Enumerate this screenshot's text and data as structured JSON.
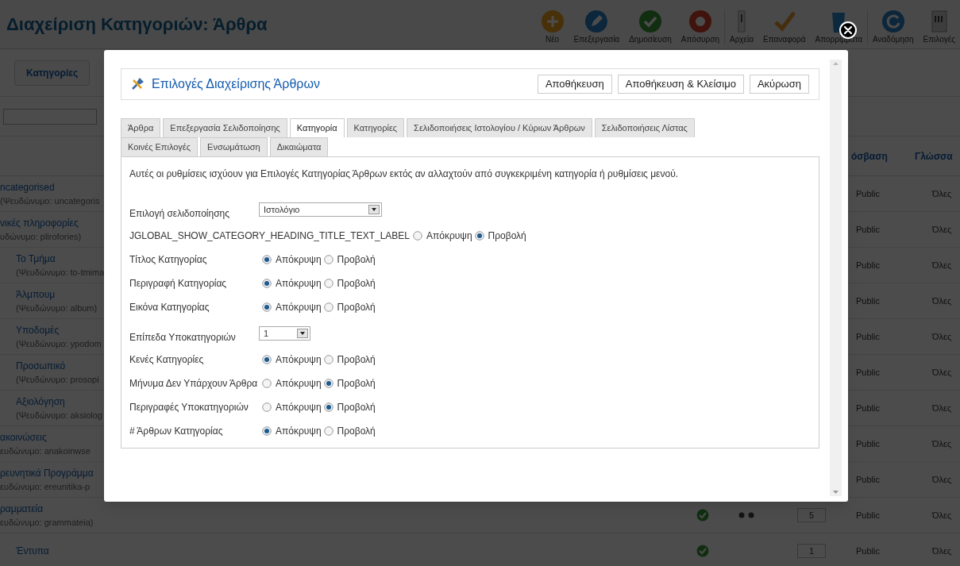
{
  "page": {
    "title": "Διαχείριση Κατηγοριών: Άρθρα",
    "toolbar": [
      {
        "label": "Νέο",
        "kind": "new"
      },
      {
        "label": "Επεξεργασία",
        "kind": "edit"
      },
      {
        "label": "Δημοσίευση",
        "kind": "publish"
      },
      {
        "label": "Απόσυρση",
        "kind": "unpublish"
      },
      {
        "label": "Αρχεία",
        "kind": "archive"
      },
      {
        "label": "Επαναφορά",
        "kind": "checkin"
      },
      {
        "label": "Απορρίμματα",
        "kind": "trash"
      },
      {
        "label": "Αναδόμηση",
        "kind": "rebuild"
      },
      {
        "label": "Επιλογές",
        "kind": "options"
      }
    ],
    "submenu": [
      "Κατηγορίες"
    ],
    "table": {
      "columns": [
        "όσβαση",
        "Γλώσσα"
      ],
      "rows": [
        {
          "title": "ncategorised",
          "alias": "(Ψευδώνυμο: uncategoris",
          "access": "Public",
          "language": "Όλες"
        },
        {
          "title": "νικές πληροφορίες",
          "alias": "υδώνυμο: plirofories)",
          "access": "Public",
          "language": "Όλες",
          "children": [
            {
              "title": "Το Τμήμα",
              "alias": "(Ψευδώνυμο: to-tmima",
              "access": "Public",
              "language": "Όλες"
            },
            {
              "title": "Άλμπουμ",
              "alias": "(Ψευδώνυμο: album)",
              "access": "Public",
              "language": "Όλες"
            },
            {
              "title": "Υποδομές",
              "alias": "(Ψευδώνυμο: ypodom",
              "access": "Public",
              "language": "Όλες"
            },
            {
              "title": "Προσωπικό",
              "alias": "(Ψευδώνυμο: prosopi",
              "access": "Public",
              "language": "Όλες"
            },
            {
              "title": "Αξιολόγηση",
              "alias": "(Ψευδώνυμο: aksiolog",
              "access": "Public",
              "language": "Όλες"
            }
          ]
        },
        {
          "title": "ακοινώσεις",
          "alias": "ευδώνυμο: anakoinwse",
          "access": "Public",
          "language": "Όλες"
        },
        {
          "title": "ρευνητικά Προγράμμα",
          "alias": "ευδώνυμο: ereunitika-p",
          "access": "Public",
          "language": "Όλες"
        },
        {
          "title": "ραμματεία",
          "alias": "ευδώνυμο: grammateia)",
          "access": "Public",
          "language": "Όλες",
          "published": true,
          "order": "5",
          "children": [
            {
              "title": "Έντυπα",
              "access": "Public",
              "language": "Όλες",
              "published": true,
              "order": "1"
            }
          ]
        }
      ]
    }
  },
  "modal": {
    "title": "Επιλογές Διαχείρισης Άρθρων",
    "buttons": [
      "Αποθήκευση",
      "Αποθήκευση & Κλείσιμο",
      "Ακύρωση"
    ],
    "tabs": [
      {
        "label": "Άρθρα",
        "selected": false
      },
      {
        "label": "Επεξεργασία Σελιδοποίησης",
        "selected": false
      },
      {
        "label": "Κατηγορία",
        "selected": true
      },
      {
        "label": "Κατηγορίες",
        "selected": false
      },
      {
        "label": "Σελιδοποιήσεις Ιστολογίου / Κύριων Άρθρων",
        "selected": false
      },
      {
        "label": "Σελιδοποιήσεις Λίστας",
        "selected": false
      },
      {
        "label": "Κοινές Επιλογές",
        "selected": false
      },
      {
        "label": "Ενσωμάτωση",
        "selected": false
      },
      {
        "label": "Δικαιώματα",
        "selected": false
      }
    ],
    "description": "Αυτές οι ρυθμίσεις ισχύουν για Επιλογές Κατηγορίας Άρθρων εκτός αν αλλαχτούν από συγκεκριμένη κατηγορία ή ρυθμίσεις μενού.",
    "fields": [
      {
        "kind": "select",
        "label": "Επιλογή σελιδοποίησης",
        "value": "Ιστολόγιο"
      },
      {
        "kind": "radio",
        "label": "JGLOBAL_SHOW_CATEGORY_HEADING_TITLE_TEXT_LABEL",
        "options": [
          {
            "label": "Απόκρυψη",
            "selected": false
          },
          {
            "label": "Προβολή",
            "selected": true
          }
        ]
      },
      {
        "kind": "radio",
        "label": "Τίτλος Κατηγορίας",
        "options": [
          {
            "label": "Απόκρυψη",
            "selected": true
          },
          {
            "label": "Προβολή",
            "selected": false
          }
        ]
      },
      {
        "kind": "radio",
        "label": "Περιγραφή Κατηγορίας",
        "options": [
          {
            "label": "Απόκρυψη",
            "selected": true
          },
          {
            "label": "Προβολή",
            "selected": false
          }
        ]
      },
      {
        "kind": "radio",
        "label": "Εικόνα Κατηγορίας",
        "options": [
          {
            "label": "Απόκρυψη",
            "selected": true
          },
          {
            "label": "Προβολή",
            "selected": false
          }
        ]
      },
      {
        "kind": "select",
        "label": "Επίπεδα Υποκατηγοριών",
        "value": "1"
      },
      {
        "kind": "radio",
        "label": "Κενές Κατηγορίες",
        "options": [
          {
            "label": "Απόκρυψη",
            "selected": true
          },
          {
            "label": "Προβολή",
            "selected": false
          }
        ]
      },
      {
        "kind": "radio",
        "label": "Μήνυμα Δεν Υπάρχουν Άρθρα",
        "options": [
          {
            "label": "Απόκρυψη",
            "selected": false
          },
          {
            "label": "Προβολή",
            "selected": true
          }
        ]
      },
      {
        "kind": "radio",
        "label": "Περιγραφές Υποκατηγοριών",
        "options": [
          {
            "label": "Απόκρυψη",
            "selected": false
          },
          {
            "label": "Προβολή",
            "selected": true
          }
        ]
      },
      {
        "kind": "radio",
        "label": "# Άρθρων Κατηγορίας",
        "options": [
          {
            "label": "Απόκρυψη",
            "selected": true
          },
          {
            "label": "Προβολή",
            "selected": false
          }
        ]
      }
    ]
  }
}
